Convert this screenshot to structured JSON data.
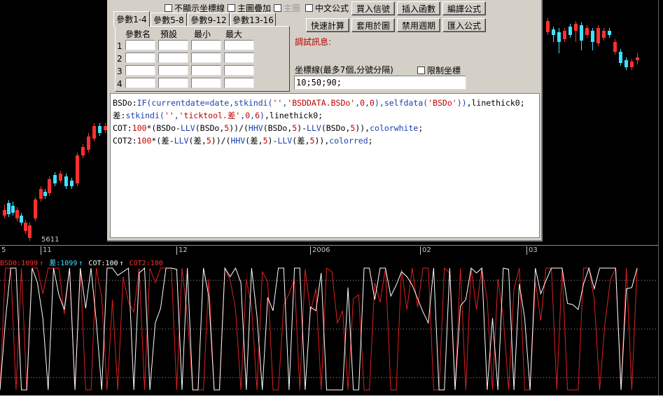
{
  "editor": {
    "checkboxes": {
      "no_axis": "不顯示坐標線",
      "main_overlay": "主圖疊加",
      "main_chart": "主圖",
      "chinese_formula": "中文公式"
    },
    "buttons": {
      "buy_signal": "買入信號",
      "insert_function": "插入函數",
      "edit_formula": "編譯公式",
      "quick_calc": "快速計算",
      "apply_chart": "套用於圖",
      "disable_period": "禁用週期",
      "import_formula": "匯入公式"
    },
    "tabs": [
      "參數1-4",
      "參數5-8",
      "參數9-12",
      "參數13-16"
    ],
    "params": {
      "headers": [
        "參數名",
        "預設",
        "最小",
        "最大"
      ],
      "rows": [
        "1",
        "2",
        "3",
        "4"
      ]
    },
    "debug_label": "調試訊息:",
    "coord_label": "坐標線(最多7個,分號分隔)",
    "limit_coord_label": "限制坐標",
    "coord_value": "10;50;90;",
    "code_lines": [
      [
        {
          "t": "BSDo:",
          "c": "var"
        },
        {
          "t": "IF(currentdate=date,stkindi(",
          "c": "func"
        },
        {
          "t": "''",
          "c": "str"
        },
        {
          "t": ",",
          "c": "func"
        },
        {
          "t": "'BSDDATA.BSDo'",
          "c": "str"
        },
        {
          "t": ",",
          "c": "func"
        },
        {
          "t": "0",
          "c": "num"
        },
        {
          "t": ",",
          "c": "func"
        },
        {
          "t": "0",
          "c": "num"
        },
        {
          "t": "),selfdata(",
          "c": "func"
        },
        {
          "t": "'BSDo'",
          "c": "str"
        },
        {
          "t": "))",
          "c": "func"
        },
        {
          "t": ",linethick0;",
          "c": "var"
        }
      ],
      [
        {
          "t": "差:",
          "c": "var"
        },
        {
          "t": "stkindi(",
          "c": "func"
        },
        {
          "t": "''",
          "c": "str"
        },
        {
          "t": ",",
          "c": "func"
        },
        {
          "t": "'ticktool.差'",
          "c": "str"
        },
        {
          "t": ",",
          "c": "func"
        },
        {
          "t": "0",
          "c": "num"
        },
        {
          "t": ",",
          "c": "func"
        },
        {
          "t": "6",
          "c": "num"
        },
        {
          "t": ")",
          "c": "func"
        },
        {
          "t": ",linethick0;",
          "c": "var"
        }
      ],
      [
        {
          "t": "COT:",
          "c": "var"
        },
        {
          "t": "100",
          "c": "num"
        },
        {
          "t": "*(BSDo-",
          "c": "var"
        },
        {
          "t": "LLV",
          "c": "func"
        },
        {
          "t": "(BSDo,",
          "c": "var"
        },
        {
          "t": "5",
          "c": "num"
        },
        {
          "t": "))/(",
          "c": "var"
        },
        {
          "t": "HHV",
          "c": "func"
        },
        {
          "t": "(BSDo,",
          "c": "var"
        },
        {
          "t": "5",
          "c": "num"
        },
        {
          "t": ")-",
          "c": "var"
        },
        {
          "t": "LLV",
          "c": "func"
        },
        {
          "t": "(BSDo,",
          "c": "var"
        },
        {
          "t": "5",
          "c": "num"
        },
        {
          "t": ")),",
          "c": "var"
        },
        {
          "t": "colorwhite",
          "c": "func"
        },
        {
          "t": ";",
          "c": "var"
        }
      ],
      [
        {
          "t": "COT2:",
          "c": "var"
        },
        {
          "t": "100",
          "c": "num"
        },
        {
          "t": "*(差-",
          "c": "var"
        },
        {
          "t": "LLV",
          "c": "func"
        },
        {
          "t": "(差,",
          "c": "var"
        },
        {
          "t": "5",
          "c": "num"
        },
        {
          "t": "))/(",
          "c": "var"
        },
        {
          "t": "HHV",
          "c": "func"
        },
        {
          "t": "(差,",
          "c": "var"
        },
        {
          "t": "5",
          "c": "num"
        },
        {
          "t": ")-",
          "c": "var"
        },
        {
          "t": "LLV",
          "c": "func"
        },
        {
          "t": "(差,",
          "c": "var"
        },
        {
          "t": "5",
          "c": "num"
        },
        {
          "t": ")),",
          "c": "var"
        },
        {
          "t": "colorred",
          "c": "func"
        },
        {
          "t": ";",
          "c": "var"
        }
      ]
    ]
  },
  "price_chart": {
    "low_label": "5611",
    "axis_labels": [
      "5",
      "11",
      "12",
      "2006",
      "02",
      "03"
    ]
  },
  "indicator": {
    "legend": [
      {
        "text": "BSD0:1099",
        "color": "#ff3030"
      },
      {
        "text": "↑",
        "color": "#ff3030"
      },
      {
        "text": "差:1099",
        "color": "#40e0ff"
      },
      {
        "text": "↑",
        "color": "#40e0ff"
      },
      {
        "text": "COT:100",
        "color": "#ffffff"
      },
      {
        "text": "↑",
        "color": "#ffffff"
      },
      {
        "text": "COT2:100",
        "color": "#ff3030"
      }
    ]
  },
  "colors": {
    "up_candle": "#ff3030",
    "down_candle": "#40e0ff",
    "cot_line": "#ffffff",
    "cot2_line": "#e02020"
  }
}
